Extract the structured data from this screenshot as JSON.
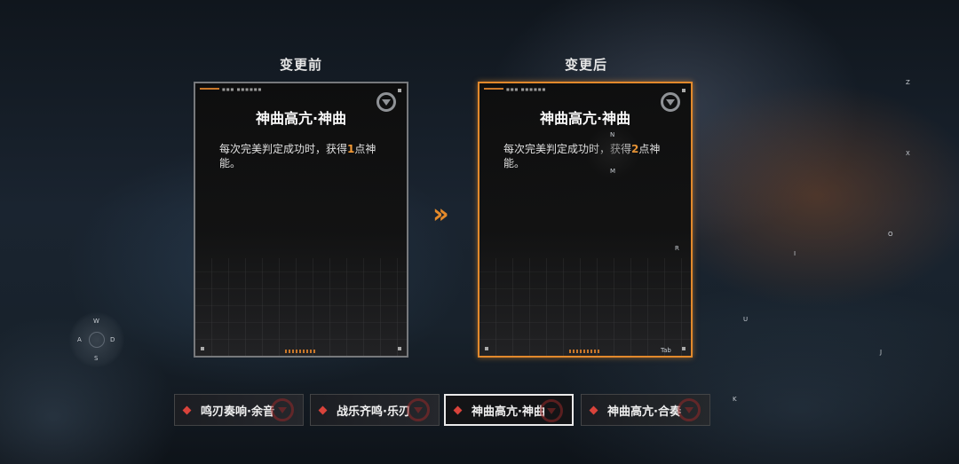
{
  "comparison": {
    "before_label": "变更前",
    "after_label": "变更后"
  },
  "before_card": {
    "title": "神曲高亢·神曲",
    "desc_prefix": "每次完美判定成功时，获得",
    "desc_value": "1",
    "desc_suffix": "点神能。"
  },
  "after_card": {
    "title": "神曲高亢·神曲",
    "desc_prefix": "每次完美判定成功时，获得",
    "desc_value": "2",
    "desc_suffix": "点神能。"
  },
  "tabs": [
    {
      "label": "鸣刃奏响·余音",
      "active": false
    },
    {
      "label": "战乐齐鸣·乐刃",
      "active": false
    },
    {
      "label": "神曲高亢·神曲",
      "active": true
    },
    {
      "label": "神曲高亢·合奏",
      "active": false
    }
  ],
  "key_hints": {
    "w": "W",
    "a": "A",
    "s": "S",
    "d": "D",
    "n": "N",
    "m": "M",
    "r": "R",
    "z": "Z",
    "x": "X",
    "o": "O",
    "i": "I",
    "u": "U",
    "j": "J",
    "k": "K",
    "tab": "Tab"
  },
  "colors": {
    "accent": "#e2892c",
    "highlight_number": "#f39a36",
    "tab_diamond": "#d9433b"
  },
  "icons": {
    "arrow": "double-chevron-right-icon",
    "card_badge": "skill-badge-icon"
  }
}
